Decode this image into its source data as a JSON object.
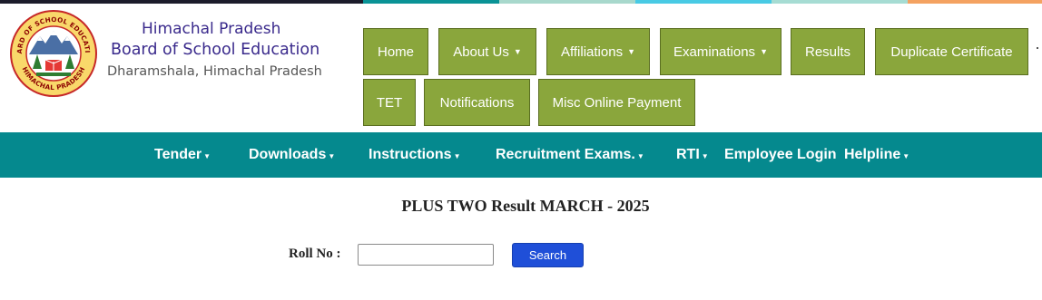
{
  "colors": {
    "accent_bar": [
      "#1a1a2e",
      "#0a9396",
      "#94d2bd",
      "#48cae4",
      "#90e0d8",
      "#f4a261"
    ],
    "menu_green": "#8aa63c",
    "navbar_teal": "#05898e",
    "brand_purple": "#3a2a8c",
    "search_blue": "#1f4fd8"
  },
  "header": {
    "logo": {
      "top_text": "BOARD OF SCHOOL EDUCATION",
      "bottom_text": "HIMACHAL PRADESH"
    },
    "brand_line1": "Himachal Pradesh",
    "brand_line2": "Board of School Education",
    "brand_line3": "Dharamshala, Himachal Pradesh"
  },
  "main_menu": {
    "home": "Home",
    "about": "About Us",
    "affiliations": "Affiliations",
    "examinations": "Examinations",
    "results": "Results",
    "duplicate_certificate": "Duplicate Certificate",
    "tet": "TET",
    "notifications": "Notifications",
    "misc_payment": "Misc Online Payment",
    "caret_icon": "caret-down-icon"
  },
  "navbar": {
    "tender": "Tender",
    "downloads": "Downloads",
    "instructions": "Instructions",
    "recruitment": "Recruitment Exams.",
    "rti": "RTI",
    "employee_login": "Employee Login",
    "helpline": "Helpline"
  },
  "result": {
    "title": "PLUS TWO Result MARCH - 2025",
    "roll_label": "Roll No :",
    "roll_value": "",
    "search_label": "Search"
  }
}
